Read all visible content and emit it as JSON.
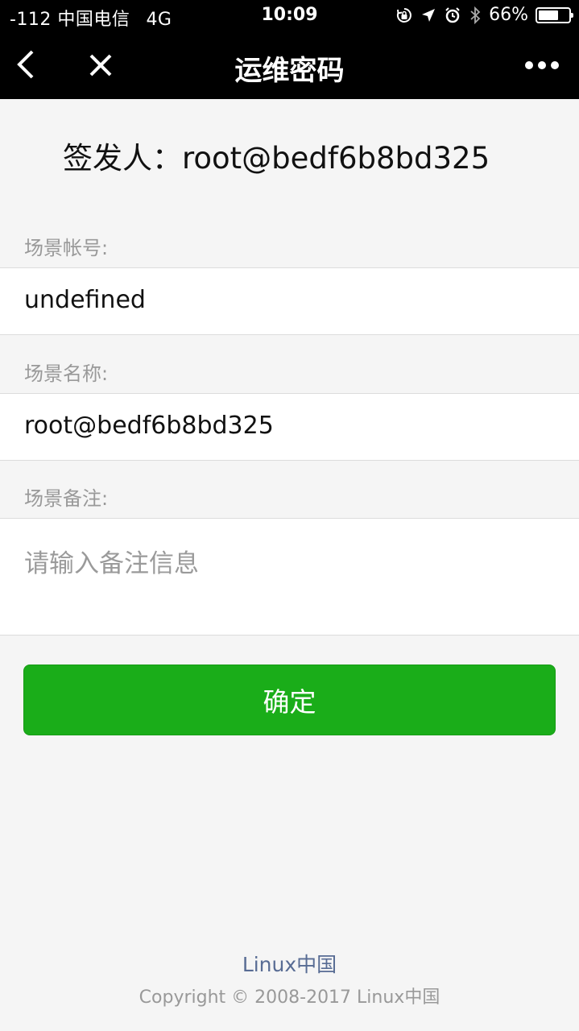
{
  "status_bar": {
    "carrier": "-112 中国电信",
    "network": "4G",
    "time": "10:09",
    "battery_percent": "66%",
    "battery_level": 0.66,
    "icons": [
      "orientation-lock-icon",
      "location-icon",
      "alarm-icon",
      "bluetooth-icon",
      "battery-icon"
    ]
  },
  "navbar": {
    "title": "运维密码",
    "back_icon": "chevron-left-icon",
    "close_icon": "close-icon",
    "more_icon": "more-icon"
  },
  "issuer": {
    "text": "签发人：root@bedf6b8bd325"
  },
  "fields": {
    "account_label": "场景帐号:",
    "account_value": "undefined",
    "name_label": "场景名称:",
    "name_value": "root@bedf6b8bd325",
    "remark_label": "场景备注:",
    "remark_placeholder": "请输入备注信息"
  },
  "confirm_button": {
    "label": "确定"
  },
  "footer": {
    "link": "Linux中国",
    "copyright": "Copyright © 2008-2017 Linux中国"
  },
  "colors": {
    "topbar": "#000000",
    "background": "#f5f5f5",
    "button": "#1aad19",
    "link": "#586c94"
  }
}
